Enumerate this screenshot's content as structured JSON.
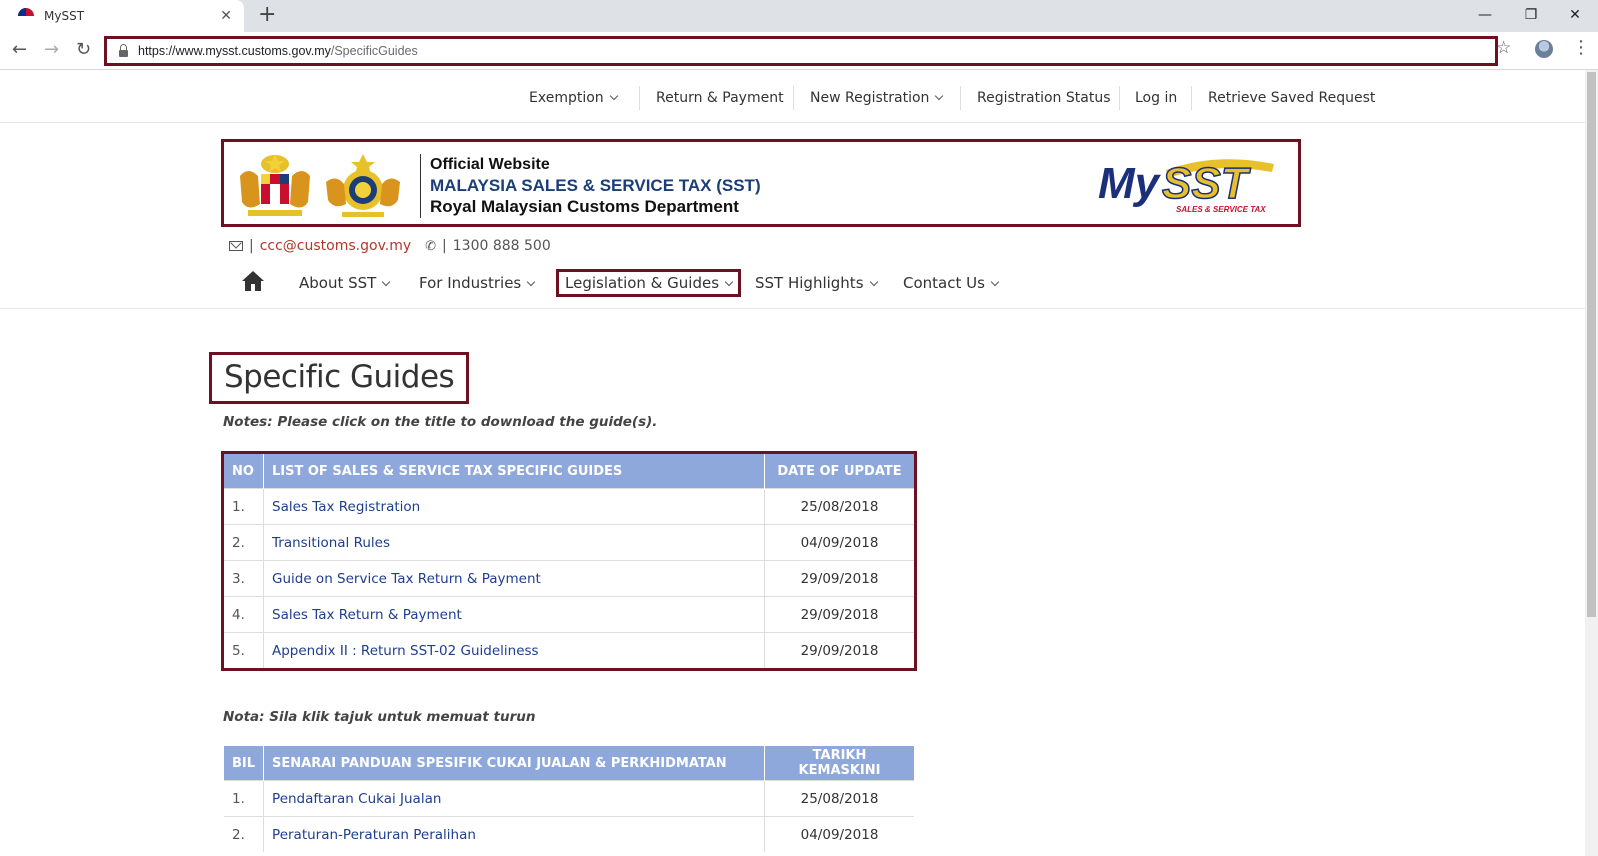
{
  "browser": {
    "tab_title": "MySST",
    "tab_close": "✕",
    "new_tab": "+",
    "win_minimize": "—",
    "win_restore": "❐",
    "win_close": "✕",
    "url_host": "https://www.mysst.customs.gov.my",
    "url_path": "/SpecificGuides",
    "back": "←",
    "forward": "→",
    "reload": "↻",
    "star": "☆",
    "menu": "⋮"
  },
  "topnav": {
    "exemption": "Exemption",
    "return_payment": "Return & Payment",
    "new_registration": "New Registration",
    "registration_status": "Registration Status",
    "login": "Log in",
    "retrieve": "Retrieve Saved Request"
  },
  "banner": {
    "line1": "Official Website",
    "line2": "MALAYSIA SALES & SERVICE TAX (SST)",
    "line3": "Royal Malaysian Customs Department",
    "logo_text": "MySST",
    "logo_sub": "SALES & SERVICE TAX"
  },
  "contact": {
    "email": "ccc@customs.gov.my",
    "phone": "1300 888 500",
    "sep": "|"
  },
  "mainnav": {
    "about": "About SST",
    "industries": "For Industries",
    "legislation": "Legislation & Guides",
    "highlights": "SST Highlights",
    "contact": "Contact Us"
  },
  "page": {
    "title": "Specific Guides",
    "note_en": "Notes: Please click on the title to download the guide(s).",
    "note_ms": "Nota: Sila klik tajuk untuk memuat turun"
  },
  "table_en": {
    "headers": [
      "NO",
      "LIST OF SALES & SERVICE TAX SPECIFIC GUIDES",
      "DATE OF UPDATE"
    ],
    "rows": [
      {
        "no": "1.",
        "title": "Sales Tax Registration",
        "date": "25/08/2018"
      },
      {
        "no": "2.",
        "title": "Transitional Rules",
        "date": "04/09/2018"
      },
      {
        "no": "3.",
        "title": "Guide on Service Tax Return & Payment",
        "date": "29/09/2018"
      },
      {
        "no": "4.",
        "title": "Sales Tax Return & Payment",
        "date": "29/09/2018"
      },
      {
        "no": "5.",
        "title": "Appendix II : Return SST-02 Guideliness",
        "date": "29/09/2018"
      }
    ]
  },
  "table_ms": {
    "headers": [
      "BIL",
      "SENARAI PANDUAN SPESIFIK CUKAI JUALAN & PERKHIDMATAN",
      "TARIKH KEMASKINI"
    ],
    "rows": [
      {
        "no": "1.",
        "title": "Pendaftaran Cukai Jualan",
        "date": "25/08/2018"
      },
      {
        "no": "2.",
        "title": "Peraturan-Peraturan Peralihan",
        "date": "04/09/2018"
      }
    ]
  }
}
